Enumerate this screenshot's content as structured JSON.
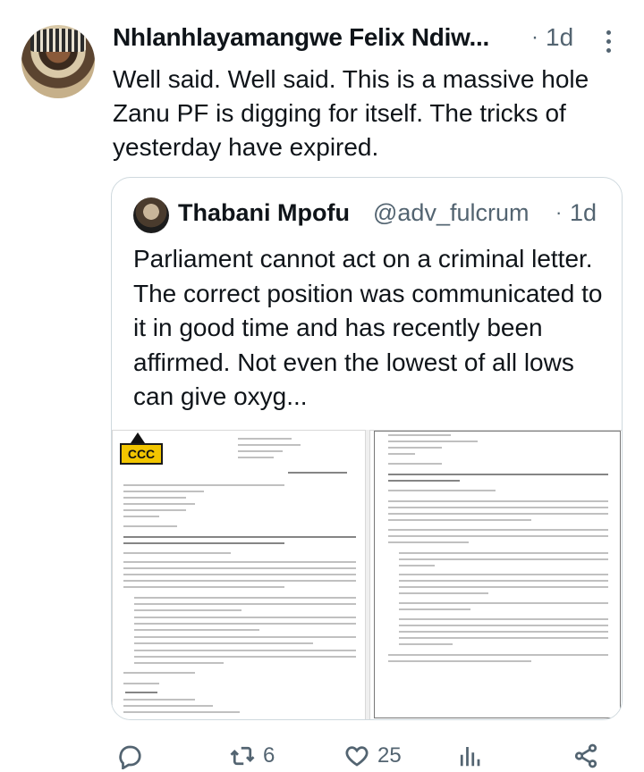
{
  "tweet": {
    "author": "Nhlanhlayamangwe Felix Ndiw...",
    "time": "1d",
    "text": "Well said. Well said. This is a massive hole Zanu PF is digging for itself. The tricks of yesterday have  expired."
  },
  "quoted": {
    "author": "Thabani Mpofu",
    "handle": "@adv_fulcrum",
    "time": "1d",
    "text": "Parliament cannot act on a criminal letter. The correct position was communicated to it in good time and has recently been affirmed. Not even the lowest of all lows can give oxyg..."
  },
  "actions": {
    "reply_count": "",
    "retweet_count": "6",
    "like_count": "25"
  },
  "colors": {
    "text": "#0f1419",
    "muted": "#536471",
    "border": "#cfd9de",
    "ccc_yellow": "#f2c500"
  },
  "icons": [
    "more-icon",
    "reply-icon",
    "retweet-icon",
    "like-icon",
    "analytics-icon",
    "share-icon"
  ]
}
